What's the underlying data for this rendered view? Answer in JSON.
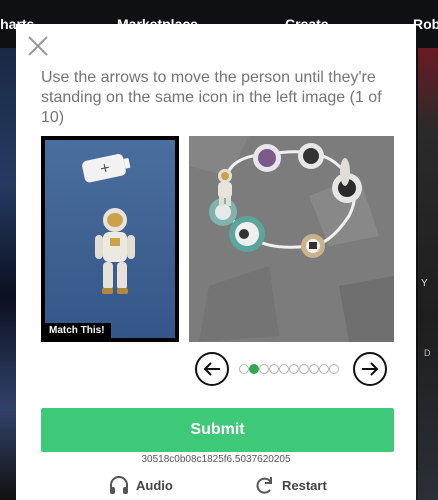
{
  "background": {
    "nav_items": [
      "Charts",
      "Marketplace",
      "Create",
      "Rob"
    ],
    "right_text": "Y",
    "right_text2": "D"
  },
  "modal": {
    "instruction": "Use the arrows to move the person until they're standing on the same icon in the left image (1 of 10)",
    "match_label": "Match This!",
    "pagination": {
      "total": 10,
      "active_index": 1
    },
    "submit_label": "Submit",
    "session_id": "30518c0b08c1825f6.5037620205",
    "audio_label": "Audio",
    "restart_label": "Restart"
  },
  "colors": {
    "submit": "#3ec978",
    "active_dot": "#32a852",
    "instruction_text": "#757575"
  },
  "icons": [
    "close-icon",
    "arrow-left-icon",
    "arrow-right-icon",
    "headphones-icon",
    "restart-icon",
    "battery-icon",
    "astronaut-icon"
  ]
}
